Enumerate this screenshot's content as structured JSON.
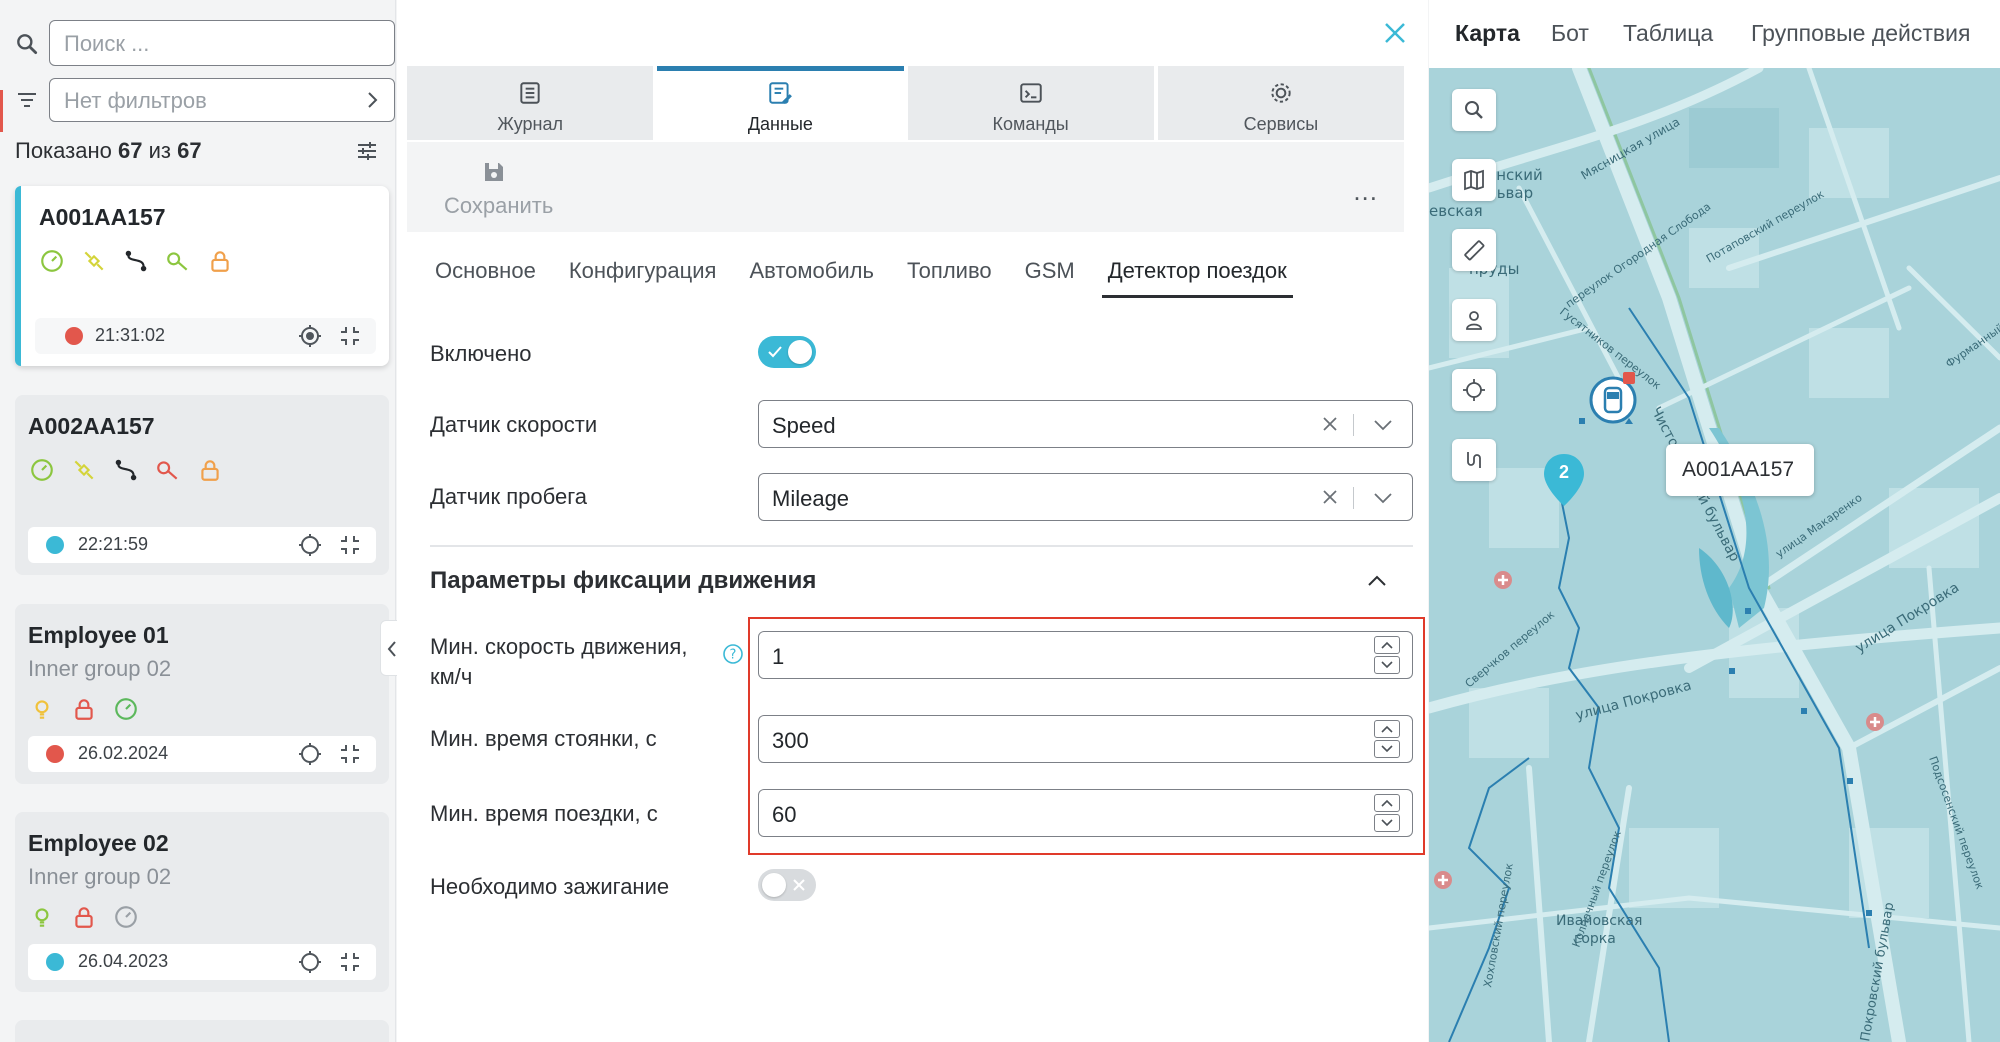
{
  "left_panel": {
    "search_placeholder": "Поиск ...",
    "filter_label": "Нет фильтров",
    "shown_prefix": "Показано",
    "shown_count": "67",
    "shown_of": "из",
    "shown_total": "67",
    "units": [
      {
        "name": "A001AA157",
        "group": "",
        "status_color": "#e2574c",
        "time": "21:31:02",
        "selected": true
      },
      {
        "name": "A002AA157",
        "group": "",
        "status_color": "#3bb9d6",
        "time": "22:21:59",
        "selected": false
      },
      {
        "name": "Employee 01",
        "group": "Inner group 02",
        "status_color": "#e2574c",
        "time": "26.02.2024",
        "selected": false
      },
      {
        "name": "Employee 02",
        "group": "Inner group 02",
        "status_color": "#3bb9d6",
        "time": "26.04.2023",
        "selected": false
      }
    ]
  },
  "detail": {
    "tabs": [
      {
        "label": "Журнал",
        "icon": "journal-icon"
      },
      {
        "label": "Данные",
        "icon": "data-icon",
        "active": true
      },
      {
        "label": "Команды",
        "icon": "terminal-icon"
      },
      {
        "label": "Сервисы",
        "icon": "services-gear-icon"
      }
    ],
    "save_label": "Сохранить",
    "more_label": "...",
    "subtabs": [
      "Основное",
      "Конфигурация",
      "Автомобиль",
      "Топливо",
      "GSM",
      "Детектор поездок"
    ],
    "active_subtab": "Детектор поездок",
    "enabled_label": "Включено",
    "enabled": true,
    "speed_sensor_label": "Датчик скорости",
    "speed_sensor_value": "Speed",
    "mileage_sensor_label": "Датчик пробега",
    "mileage_sensor_value": "Mileage",
    "section_title": "Параметры фиксации движения",
    "min_speed_label_1": "Мин. скорость движения,",
    "min_speed_label_2": "км/ч",
    "min_speed_value": "1",
    "min_stop_label": "Мин. время стоянки, с",
    "min_stop_value": "300",
    "min_trip_label": "Мин. время поездки, с",
    "min_trip_value": "60",
    "ignition_label": "Необходимо зажигание",
    "ignition_required": false
  },
  "map": {
    "tabs": [
      "Карта",
      "Бот",
      "Таблица",
      "Групповые действия"
    ],
    "active_tab": "Карта",
    "vehicle_label": "A001AA157",
    "cluster_count": "2",
    "street_labels": [
      "Мясницкая улица",
      "етенский",
      "бульвар",
      "евская",
      "ые",
      "пруды",
      "переулок Огородная Слобода",
      "Гусятников переулок",
      "Чистопрудный бульвар",
      "улица Макаренко",
      "улица Покровка",
      "Сверчков переулок",
      "Ивановская",
      "горка",
      "Подсосенский переулок",
      "Колпачный переулок",
      "Хохловский переулок",
      "Фурманный переулок",
      "Потаповский переулок",
      "Покровский бульвар"
    ],
    "colors": {
      "water": "#5fb8cc",
      "map_bg": "#a9d3da",
      "road": "#d5ecef"
    }
  }
}
